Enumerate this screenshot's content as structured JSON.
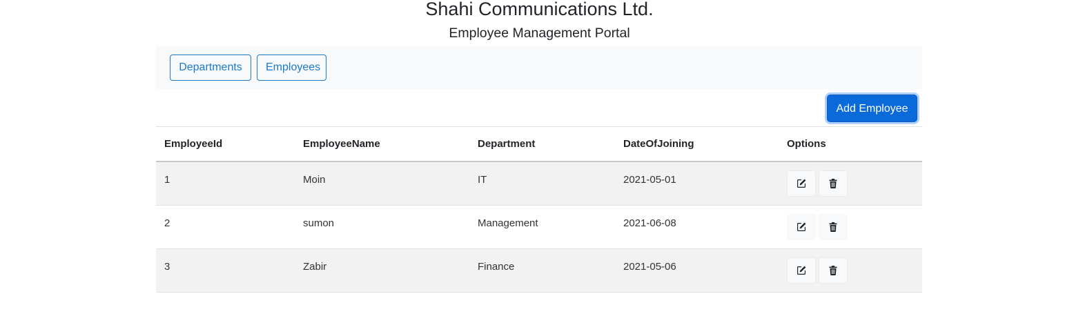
{
  "header": {
    "title": "Shahi Communications Ltd.",
    "subtitle": "Employee Management Portal"
  },
  "nav": {
    "departments_label": "Departments",
    "employees_label": "Employees"
  },
  "actions": {
    "add_employee_label": "Add Employee"
  },
  "table": {
    "columns": [
      "EmployeeId",
      "EmployeeName",
      "Department",
      "DateOfJoining",
      "Options"
    ],
    "rows": [
      {
        "id": "1",
        "name": "Moin",
        "department": "IT",
        "date": "2021-05-01"
      },
      {
        "id": "2",
        "name": "sumon",
        "department": "Management",
        "date": "2021-06-08"
      },
      {
        "id": "3",
        "name": "Zabir",
        "department": "Finance",
        "date": "2021-05-06"
      }
    ],
    "row_icons": [
      "edit-icon",
      "trash-icon"
    ]
  },
  "colors": {
    "primary": "#0a6ad9",
    "outline": "#1b7ac9",
    "navbar_bg": "#f8f9fa",
    "stripe_bg": "#f2f2f2"
  }
}
